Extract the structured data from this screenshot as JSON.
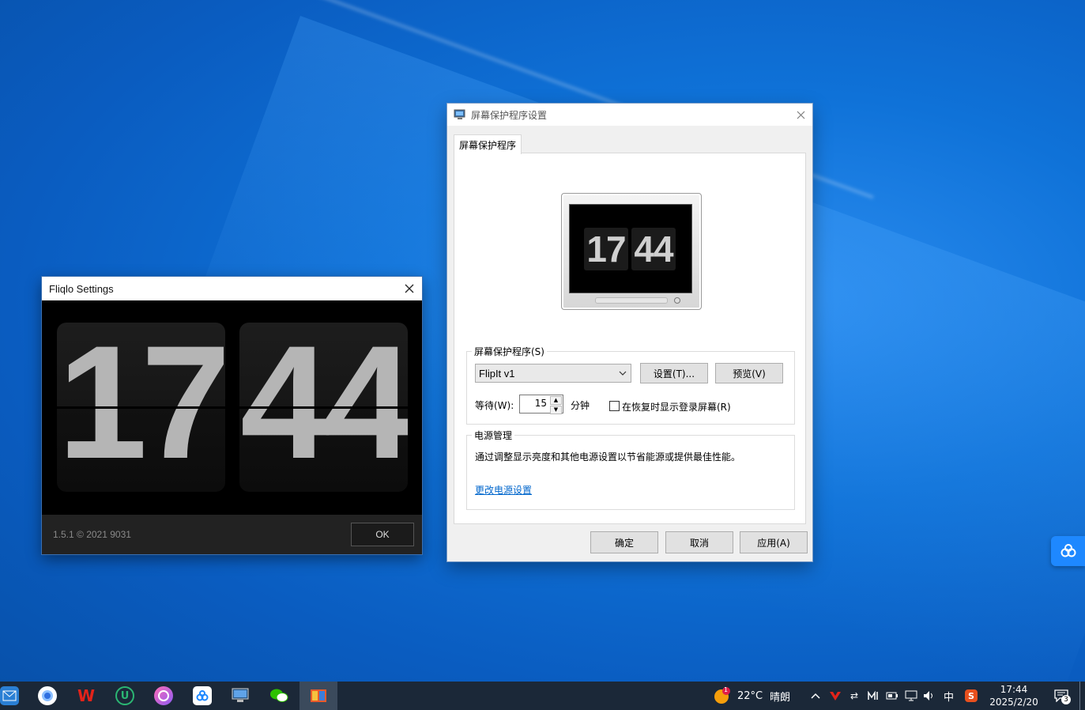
{
  "fliqlo": {
    "title": "Fliqlo Settings",
    "hours": "17",
    "minutes": "44",
    "version": "1.5.1 © 2021 9031",
    "ok_label": "OK"
  },
  "dialog": {
    "title": "屏幕保护程序设置",
    "tab_label": "屏幕保护程序",
    "preview": {
      "hours": "17",
      "minutes": "44"
    },
    "screensaver_group": {
      "legend": "屏幕保护程序(S)",
      "selected": "FlipIt v1",
      "settings_label": "设置(T)...",
      "preview_label": "预览(V)",
      "wait_label": "等待(W):",
      "wait_value": "15",
      "minutes_label": "分钟",
      "resume_checkbox_label": "在恢复时显示登录屏幕(R)",
      "resume_checked": false
    },
    "power_group": {
      "legend": "电源管理",
      "description": "通过调整显示亮度和其他电源设置以节省能源或提供最佳性能。",
      "link_label": "更改电源设置"
    },
    "buttons": {
      "ok": "确定",
      "cancel": "取消",
      "apply": "应用(A)"
    }
  },
  "taskbar": {
    "apps": [
      {
        "name": "mail",
        "color": "#2a7fd4"
      },
      {
        "name": "browser",
        "color": "#2f6fe0"
      },
      {
        "name": "wps",
        "color": "#e2231a",
        "glyph": "W"
      },
      {
        "name": "editor",
        "color": "#2bb673",
        "glyph": "U"
      },
      {
        "name": "media",
        "color": "#b14bd6"
      },
      {
        "name": "cloud-drive",
        "color": "#ffffff"
      },
      {
        "name": "screensaver-monitor",
        "color": "#5fa3e8"
      },
      {
        "name": "wechat",
        "color": "#2dc100"
      },
      {
        "name": "fliqlo-active",
        "color": "#e85a2a"
      }
    ],
    "weather": {
      "temp": "22°C",
      "condition": "晴朗",
      "badge": "1"
    },
    "ime": "中",
    "clock": {
      "time": "17:44",
      "date": "2025/2/20"
    },
    "notification_count": "3"
  }
}
